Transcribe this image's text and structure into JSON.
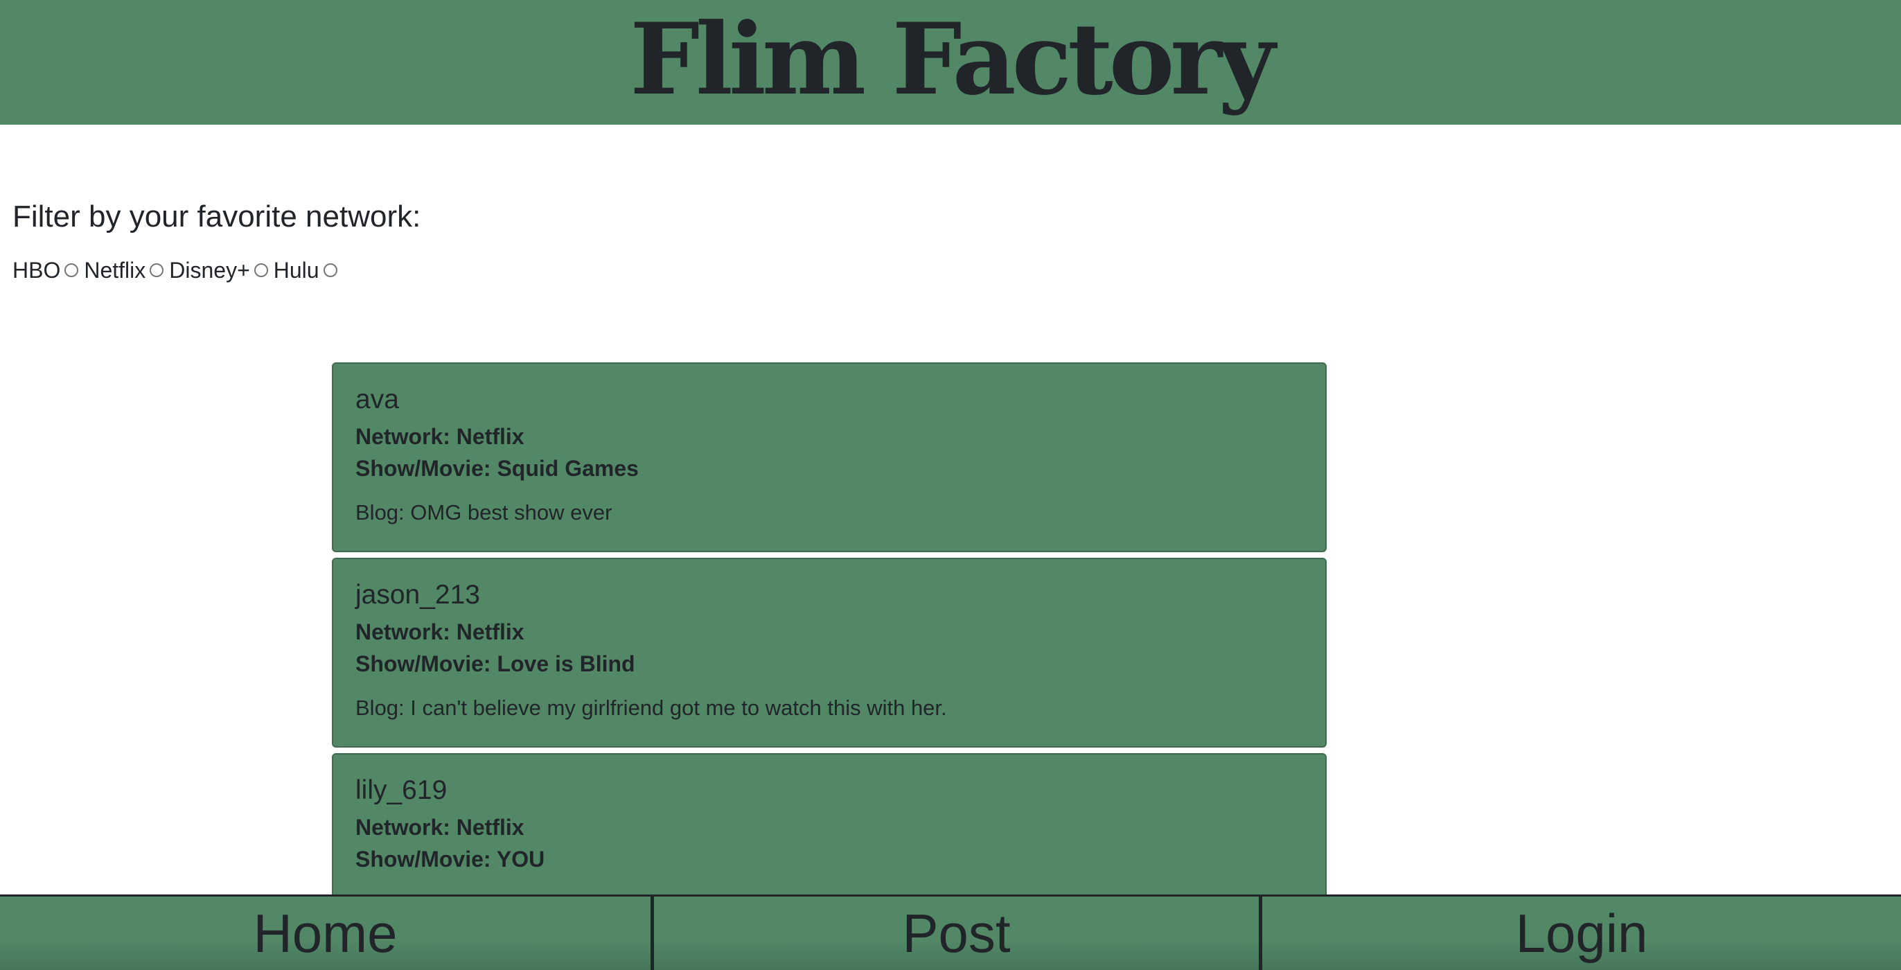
{
  "header": {
    "title": "Flim Factory",
    "background": "#528866"
  },
  "filter": {
    "heading": "Filter by your favorite network:",
    "options": [
      {
        "label": "HBO",
        "selected": false
      },
      {
        "label": "Netflix",
        "selected": false
      },
      {
        "label": "Disney+",
        "selected": false
      },
      {
        "label": "Hulu",
        "selected": false
      }
    ]
  },
  "posts": [
    {
      "user": "ava",
      "network": "Network: Netflix",
      "show": "Show/Movie: Squid Games",
      "blog": "Blog: OMG best show ever"
    },
    {
      "user": "jason_213",
      "network": "Network: Netflix",
      "show": "Show/Movie: Love is Blind",
      "blog": "Blog: I can't believe my girlfriend got me to watch this with her."
    },
    {
      "user": "lily_619",
      "network": "Network: Netflix",
      "show": "Show/Movie: YOU",
      "blog": ""
    }
  ],
  "nav": {
    "home": "Home",
    "post": "Post",
    "login": "Login"
  },
  "colors": {
    "accent": "#528866",
    "text": "#212529"
  }
}
